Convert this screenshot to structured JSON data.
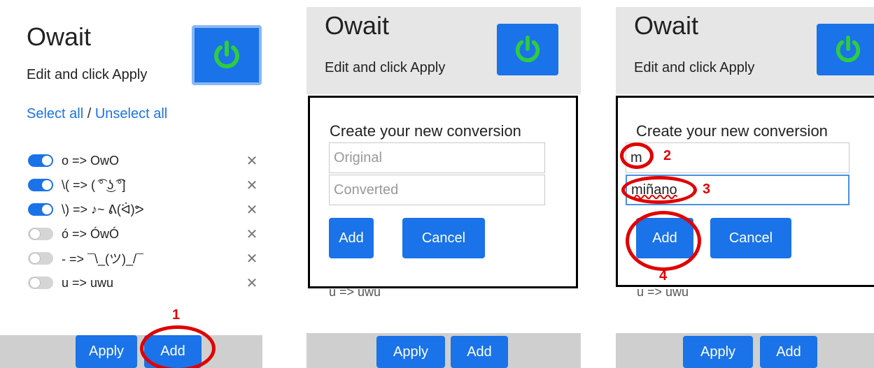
{
  "app": {
    "title": "Owait",
    "subtitle": "Edit and click Apply",
    "accent_color": "#1a73e8",
    "power_icon": "power-icon",
    "power_icon_color": "#2ecc40"
  },
  "panel1": {
    "select_all": "Select all",
    "separator": " / ",
    "unselect_all": "Unselect all",
    "rules": [
      {
        "text": "o => OwO",
        "enabled": true
      },
      {
        "text": "\\( => ( ͡° ͜ʖ ͡°]",
        "enabled": true
      },
      {
        "text": "\\) => ♪~ ᕕ(ᐛ)ᕗ",
        "enabled": true
      },
      {
        "text": "ó => ÓwÓ",
        "enabled": false
      },
      {
        "text": "- => ¯\\_(ツ)_/¯",
        "enabled": false
      },
      {
        "text": "u => uwu",
        "enabled": false
      }
    ],
    "delete_glyph": "✕",
    "apply_label": "Apply",
    "add_label": "Add",
    "annotation": "1"
  },
  "panel2": {
    "modal_title": "Create your new conversion",
    "original_placeholder": "Original",
    "converted_placeholder": "Converted",
    "add_label": "Add",
    "cancel_label": "Cancel",
    "behind_text": "u => uwu",
    "apply_label": "Apply",
    "footer_add_label": "Add"
  },
  "panel3": {
    "modal_title": "Create your new conversion",
    "original_value": "m",
    "converted_value": "miñano",
    "add_label": "Add",
    "cancel_label": "Cancel",
    "behind_text": "u => uwu",
    "apply_label": "Apply",
    "footer_add_label": "Add",
    "annotations": [
      "2",
      "3",
      "4"
    ]
  }
}
